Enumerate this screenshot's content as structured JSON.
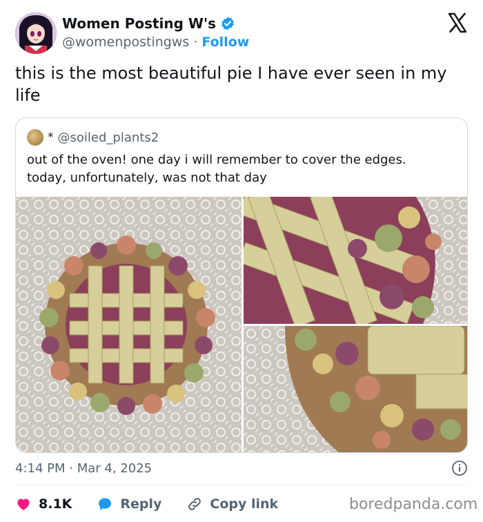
{
  "author": {
    "display_name": "Women Posting W's",
    "handle": "@womenpostingws",
    "separator": "·",
    "follow_label": "Follow",
    "avatar_icon": "anime-character-avatar",
    "verified_icon": "verified-badge-icon",
    "verified_color": "#1d9bf0"
  },
  "platform_logo": "x-logo-icon",
  "tweet": {
    "text": "this is the most beautiful pie I have ever seen in my life"
  },
  "quoted_tweet": {
    "star": "*",
    "handle": "@soiled_plants2",
    "text_line1": "out of the oven! one day i will remember to cover the edges.",
    "text_line2": "today, unfortunately, was not that day",
    "photos": [
      "lattice pie with flower crust",
      "lattice and flower close-up",
      "flower crust edge close-up"
    ]
  },
  "meta": {
    "time": "4:14 PM",
    "separator": "·",
    "date": "Mar 4, 2025",
    "info_icon": "info-icon"
  },
  "actions": {
    "likes": "8.1K",
    "reply_label": "Reply",
    "copy_link_label": "Copy link",
    "heart_color": "#f91880",
    "reply_color": "#1d9bf0"
  },
  "watermark": "boredpanda.com"
}
